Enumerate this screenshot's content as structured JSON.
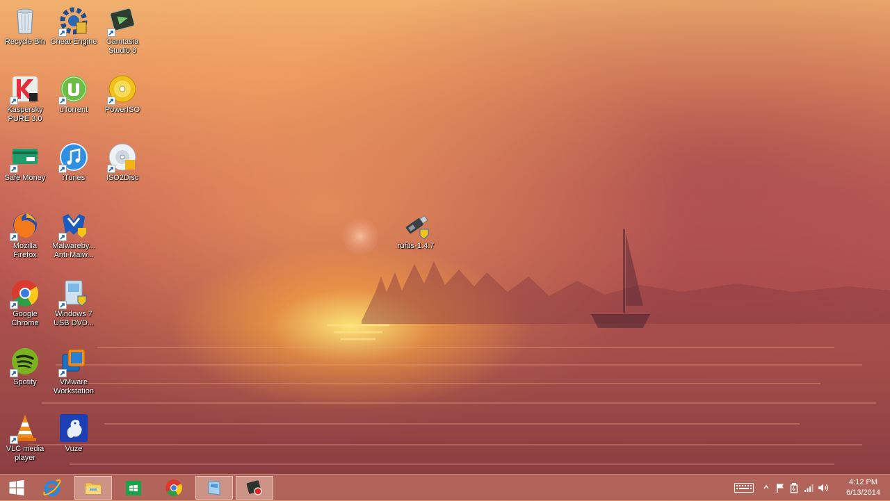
{
  "desktop": {
    "icons": [
      {
        "name": "recycle-bin",
        "label": "Recycle Bin"
      },
      {
        "name": "cheat-engine",
        "label": "Cheat Engine"
      },
      {
        "name": "camtasia-studio",
        "label": "Camtasia Studio 8"
      },
      {
        "name": "kaspersky-pure",
        "label": "Kaspersky PURE 3.0"
      },
      {
        "name": "utorrent",
        "label": "uTorrent"
      },
      {
        "name": "poweriso",
        "label": "PowerISO"
      },
      {
        "name": "safe-money",
        "label": "Safe Money"
      },
      {
        "name": "itunes",
        "label": "iTunes"
      },
      {
        "name": "iso2disc",
        "label": "ISO2Disc"
      },
      {
        "name": "mozilla-firefox",
        "label": "Mozilla Firefox"
      },
      {
        "name": "malwarebytes",
        "label": "Malwareby... Anti-Malw..."
      },
      {
        "name": "google-chrome",
        "label": "Google Chrome"
      },
      {
        "name": "windows-7-usb-dvd",
        "label": "Windows 7 USB DVD..."
      },
      {
        "name": "spotify",
        "label": "Spotify"
      },
      {
        "name": "vmware-workstation",
        "label": "VMware Workstation"
      },
      {
        "name": "vlc-media-player",
        "label": "VLC media player"
      },
      {
        "name": "vuze",
        "label": "Vuze"
      },
      {
        "name": "rufus",
        "label": "rufus-1.4.7"
      }
    ]
  },
  "taskbar": {
    "start": "start-button",
    "pinned": [
      "internet-explorer",
      "file-explorer",
      "windows-store",
      "google-chrome",
      "windows-7-usb-dvd-tool",
      "camtasia-recorder"
    ],
    "active": [
      "file-explorer",
      "windows-7-usb-dvd-tool",
      "camtasia-recorder"
    ]
  },
  "tray": {
    "time": "4:12 PM",
    "date": "6/13/2014",
    "icons": [
      "keyboard-icon",
      "show-hidden-icons",
      "flag-icon",
      "power-icon",
      "network-icon",
      "volume-icon"
    ]
  },
  "colors": {
    "taskbar": "#cd826e",
    "label_text": "#ffffff"
  }
}
